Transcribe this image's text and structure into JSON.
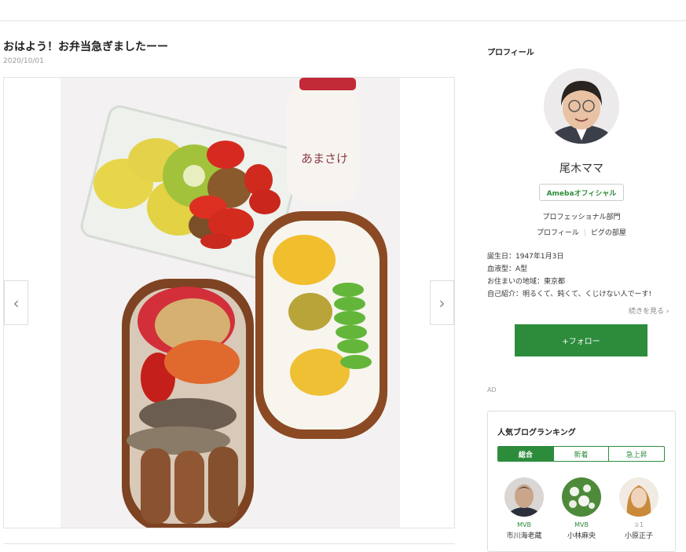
{
  "post": {
    "title": "おはよう！お弁当急ぎましたーー",
    "date": "2020/10/01",
    "photo_label": "あまさけ",
    "prev_label": "‹",
    "next_label": "›"
  },
  "sidebar": {
    "profile_heading": "プロフィール",
    "name": "尾木ママ",
    "badge": "Amebaオフィシャル",
    "category": "プロフェッショナル部門",
    "links": [
      "プロフィール",
      "ピグの部屋"
    ],
    "info": [
      "誕生日：1947年1月3日",
      "血液型：A型",
      "お住まいの地域：東京都",
      "自己紹介：明るくて、鈍くて、くじけない人でーす!"
    ],
    "more_label": "続きを見る ›",
    "follow_label": "+フォロー",
    "ad_label": "AD"
  },
  "ranking": {
    "title": "人気ブログランキング",
    "tabs": [
      "総合",
      "新着",
      "急上昇"
    ],
    "items": [
      {
        "badge": "MVB",
        "name": "市川海老蔵"
      },
      {
        "badge": "MVB",
        "name": "小林麻央"
      },
      {
        "badge": "♕1",
        "name": "小原正子"
      }
    ]
  },
  "colors": {
    "accent": "#2d8c3c"
  }
}
